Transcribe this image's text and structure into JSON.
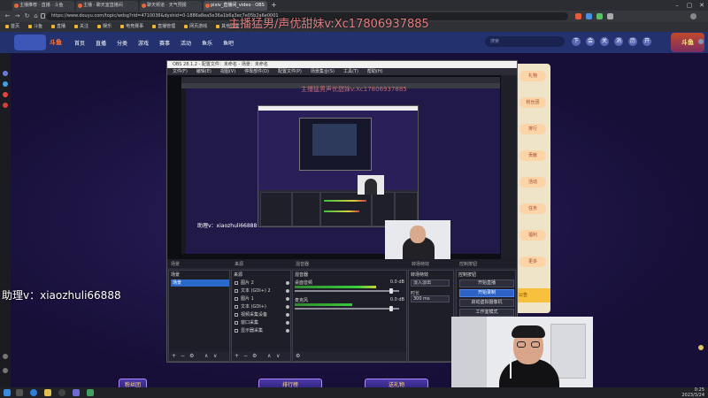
{
  "browser": {
    "tabs": [
      {
        "label": "主播推荐 · 直播 · 斗鱼",
        "active": false
      },
      {
        "label": "主播 · 聊天室直播间",
        "active": false
      },
      {
        "label": "聊天频道 · 天气预报",
        "active": false
      },
      {
        "label": "pixiv_直播间_video · OBS",
        "active": true
      }
    ],
    "url": "https://www.douyu.com/topic/wdsg?rid=4710036&dyshid=0-1886a8ea5e36a1b6a3ec7e05b2a6e0001",
    "bookmarks": [
      "首页",
      "斗鱼",
      "直播",
      "关注",
      "娱乐",
      "电竞赛事",
      "直播管理",
      "网页游戏",
      "其他收藏"
    ]
  },
  "site": {
    "logo_text": "斗鱼",
    "nav": [
      "首页",
      "直播",
      "分类",
      "游戏",
      "赛事",
      "活动",
      "鱼乐",
      "鱼吧"
    ],
    "search_placeholder": "搜索",
    "header_icons": [
      "下",
      "会",
      "关",
      "消",
      "历",
      "开"
    ],
    "right_logo": "斗鱼"
  },
  "watermark": "主播猛男/声优甜妹v:Xc17806937885",
  "watermark_small": "主播猛男声优甜妹v:Xc17806937885",
  "assistant_big": "助理v：xiaozhuli66888",
  "assistant_small": "助理v：xiaozhuli66888",
  "obs": {
    "title": "OBS 28.1.2 - 配置文件：未命名 - 场景：未命名",
    "menu": [
      "文件(F)",
      "编辑(E)",
      "视图(V)",
      "停靠部件(D)",
      "配置文件(P)",
      "场景集合(S)",
      "工具(T)",
      "帮助(H)"
    ],
    "dock_headers": {
      "scenes": "场景",
      "sources": "来源",
      "mixer": "混音器",
      "transitions": "转场特效",
      "controls": "控制按钮"
    },
    "scenes": [
      "场景"
    ],
    "sources": [
      "图片 2",
      "文本 (GDI+) 2",
      "图片 1",
      "文本 (GDI+)",
      "视频采集设备",
      "窗口采集",
      "显示器采集"
    ],
    "mixer": [
      {
        "name": "桌面音频",
        "db": "0.0 dB",
        "level": 0.78,
        "volume": 0.92
      },
      {
        "name": "麦克风",
        "db": "0.0 dB",
        "level": 0.55,
        "volume": 0.92
      }
    ],
    "transitions": {
      "type": "淡入淡出",
      "duration_label": "时长",
      "duration": "300 ms"
    },
    "controls": [
      "开始直播",
      "开始录制",
      "启动虚拟摄像机",
      "工作室模式",
      "设置",
      "退出"
    ],
    "toolbar_glyphs": [
      "+",
      "−",
      "⚙",
      "∧",
      "∨"
    ]
  },
  "right_panel": [
    "礼物",
    "粉丝团",
    "排行",
    "贡献",
    "活动",
    "任务",
    "福利",
    "更多"
  ],
  "right_notice": "公告",
  "page_banners": [
    "排行榜",
    "送礼物",
    "粉丝团"
  ],
  "taskbar": {
    "time": "0:25",
    "date": "2023/3/24"
  },
  "colors": {
    "obs_blue": "#2a68c9",
    "site_header": "#23326e",
    "watermark": "#ff8a8a"
  }
}
